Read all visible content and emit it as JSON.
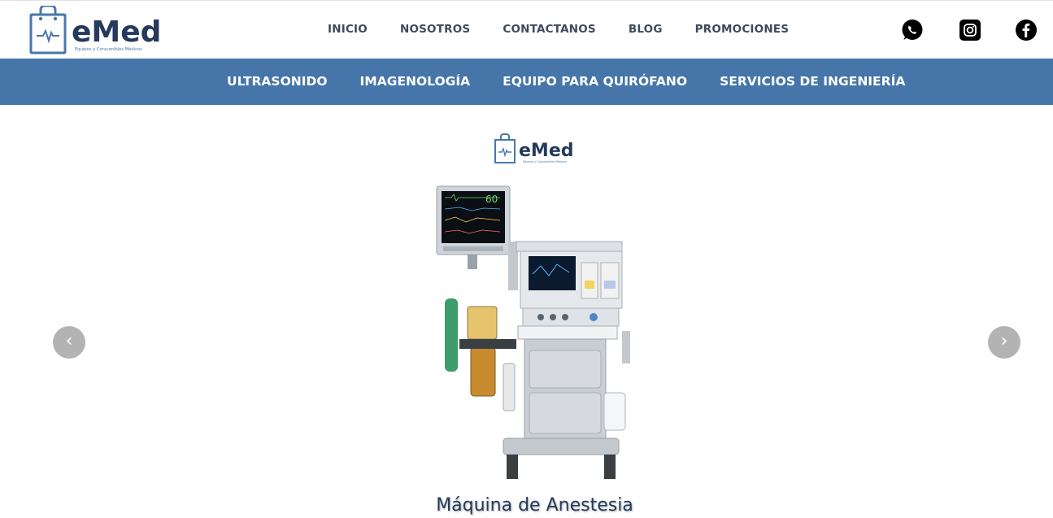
{
  "brand": {
    "name": "eMed",
    "tagline": "Equipos y Consumibles Médicos",
    "primary_color": "#253a5c",
    "accent_color": "#4675a9"
  },
  "main_nav": [
    {
      "label": "INICIO"
    },
    {
      "label": "NOSOTROS"
    },
    {
      "label": "CONTACTANOS"
    },
    {
      "label": "BLOG"
    },
    {
      "label": "PROMOCIONES"
    }
  ],
  "social": [
    {
      "name": "whatsapp-icon"
    },
    {
      "name": "instagram-icon"
    },
    {
      "name": "facebook-icon"
    }
  ],
  "category_nav": [
    {
      "label": "ULTRASONIDO"
    },
    {
      "label": "IMAGENOLOGÍA"
    },
    {
      "label": "EQUIPO PARA QUIRÓFANO"
    },
    {
      "label": "SERVICIOS DE INGENIERÍA"
    }
  ],
  "slider": {
    "title": "Máquina de Anestesia",
    "prev_label": "‹",
    "next_label": "›",
    "monitor_value": "60"
  }
}
